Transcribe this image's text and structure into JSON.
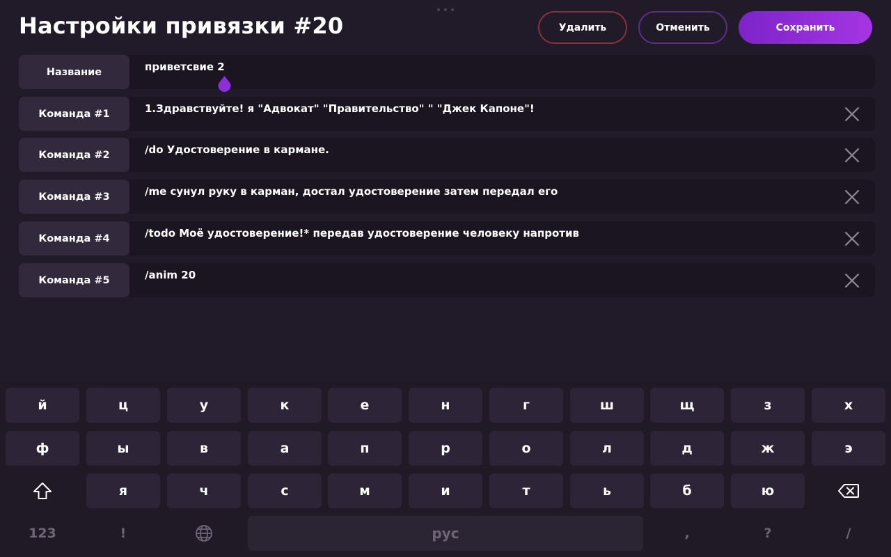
{
  "header": {
    "title": "Настройки привязки #20",
    "delete_label": "Удалить",
    "cancel_label": "Отменить",
    "save_label": "Сохранить"
  },
  "rows": [
    {
      "label": "Название",
      "value": "приветсвие 2",
      "clearable": false
    },
    {
      "label": "Команда #1",
      "value": "1.Здравствуйте! я \"Адвокат\" \"Правительство\" \" \"Джек Капоне\"!",
      "clearable": true
    },
    {
      "label": "Команда #2",
      "value": "/do Удостоверение в кармане.",
      "clearable": true
    },
    {
      "label": "Команда #3",
      "value": "/me сунул руку в карман, достал удостоверение затем передал его",
      "clearable": true
    },
    {
      "label": "Команда #4",
      "value": "/todo Моё удостоверение!* передав удостоверение человеку напротив",
      "clearable": true
    },
    {
      "label": "Команда #5",
      "value": "/anim 20",
      "clearable": true
    }
  ],
  "keyboard": {
    "row1": [
      "й",
      "ц",
      "у",
      "к",
      "е",
      "н",
      "г",
      "ш",
      "щ",
      "з",
      "х"
    ],
    "row2": [
      "ф",
      "ы",
      "в",
      "а",
      "п",
      "р",
      "о",
      "л",
      "д",
      "ж",
      "э"
    ],
    "row3": [
      "я",
      "ч",
      "с",
      "м",
      "и",
      "т",
      "ь",
      "б",
      "ю"
    ],
    "numbers_label": "123",
    "exclaim_label": "!",
    "space_label": "рус",
    "comma_label": ",",
    "question_label": "?",
    "slash_label": "/",
    "shift_icon": "shift-icon",
    "backspace_icon": "backspace-icon",
    "globe_icon": "globe-icon"
  },
  "colors": {
    "background": "#211b29",
    "accent": "#a535e4",
    "delete_border": "#8a2f3c",
    "cancel_border": "#5b2f86"
  }
}
